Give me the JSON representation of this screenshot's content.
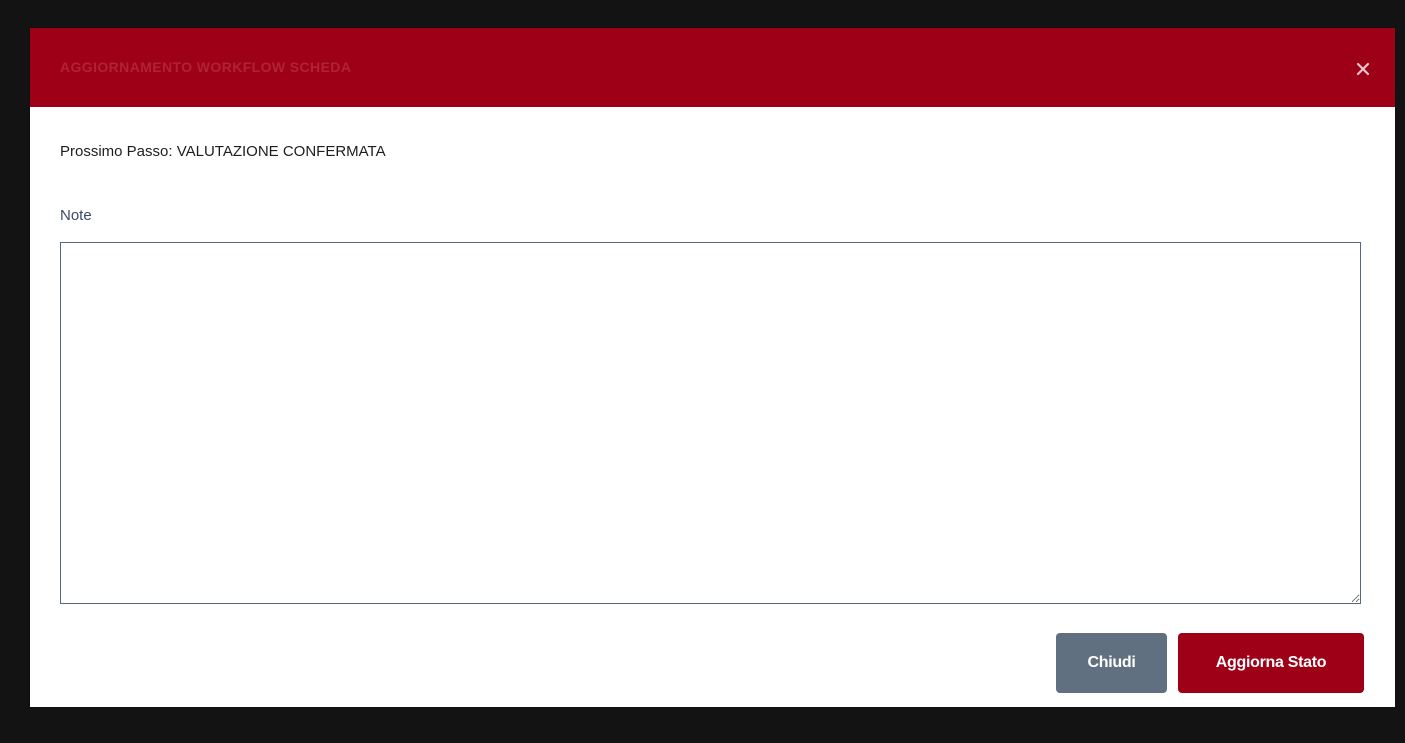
{
  "modal": {
    "title": "AGGIORNAMENTO WORKFLOW SCHEDA",
    "next_step": "Prossimo Passo: VALUTAZIONE CONFERMATA",
    "note_label": "Note",
    "note_value": "",
    "buttons": {
      "close_label": "Chiudi",
      "update_label": "Aggiorna Stato"
    }
  },
  "icons": {
    "close": "close-icon"
  },
  "colors": {
    "header_bg": "#9e0018",
    "primary_button": "#9e0018",
    "secondary_button": "#617080",
    "label_text": "#3b4a64"
  }
}
